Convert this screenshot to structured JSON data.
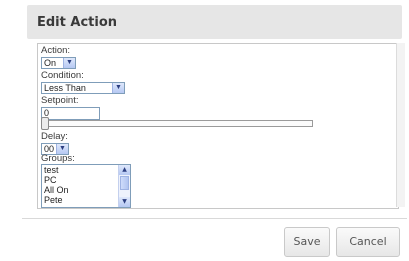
{
  "dialog": {
    "title": "Edit Action"
  },
  "form": {
    "action": {
      "label": "Action:",
      "selected": "On"
    },
    "condition": {
      "label": "Condition:",
      "selected": "Less Than"
    },
    "setpoint": {
      "label": "Setpoint:",
      "value": "0",
      "slider_level": 0
    },
    "delay": {
      "label": "Delay:",
      "selected": "00"
    },
    "groups": {
      "label": "Groups:",
      "options": [
        "test",
        "PC",
        "All On",
        "Pete"
      ]
    }
  },
  "footer": {
    "save_label": "Save",
    "cancel_label": "Cancel"
  },
  "icons": {
    "dropdown_arrow": "chevron-down-icon",
    "scroll_up": "chevron-up-icon",
    "scroll_down": "chevron-down-icon"
  }
}
